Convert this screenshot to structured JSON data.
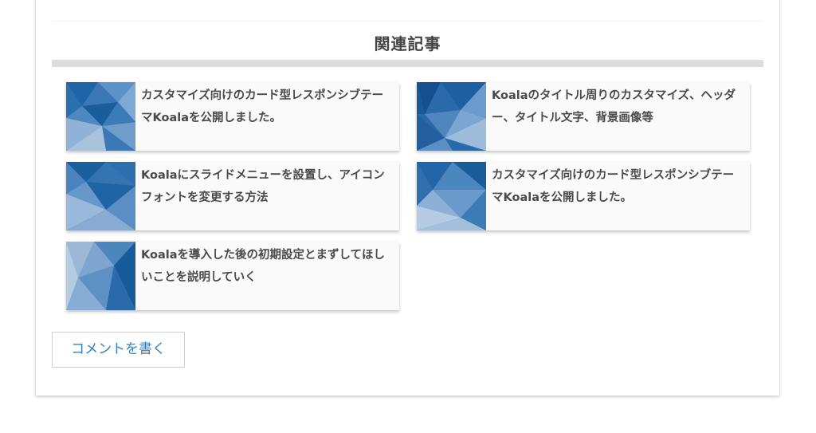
{
  "related": {
    "heading": "関連記事",
    "articles": [
      {
        "title": "カスタマイズ向けのカード型レスポンシブテーマKoalaを公開しました。"
      },
      {
        "title": "Koalaのタイトル周りのカスタマイズ、ヘッダー、タイトル文字、背景画像等"
      },
      {
        "title": "Koalaにスライドメニューを設置し、アイコンフォントを変更する方法"
      },
      {
        "title": "カスタマイズ向けのカード型レスポンシブテーマKoalaを公開しました。"
      },
      {
        "title": "Koalaを導入した後の初期設定とまずしてほしいことを説明していく"
      }
    ]
  },
  "comment": {
    "button_label": "コメントを書く"
  },
  "colors": {
    "accent": "#2f83c3",
    "thumb_dark": "#1a5d9c",
    "thumb_light": "#a9c3dd"
  }
}
